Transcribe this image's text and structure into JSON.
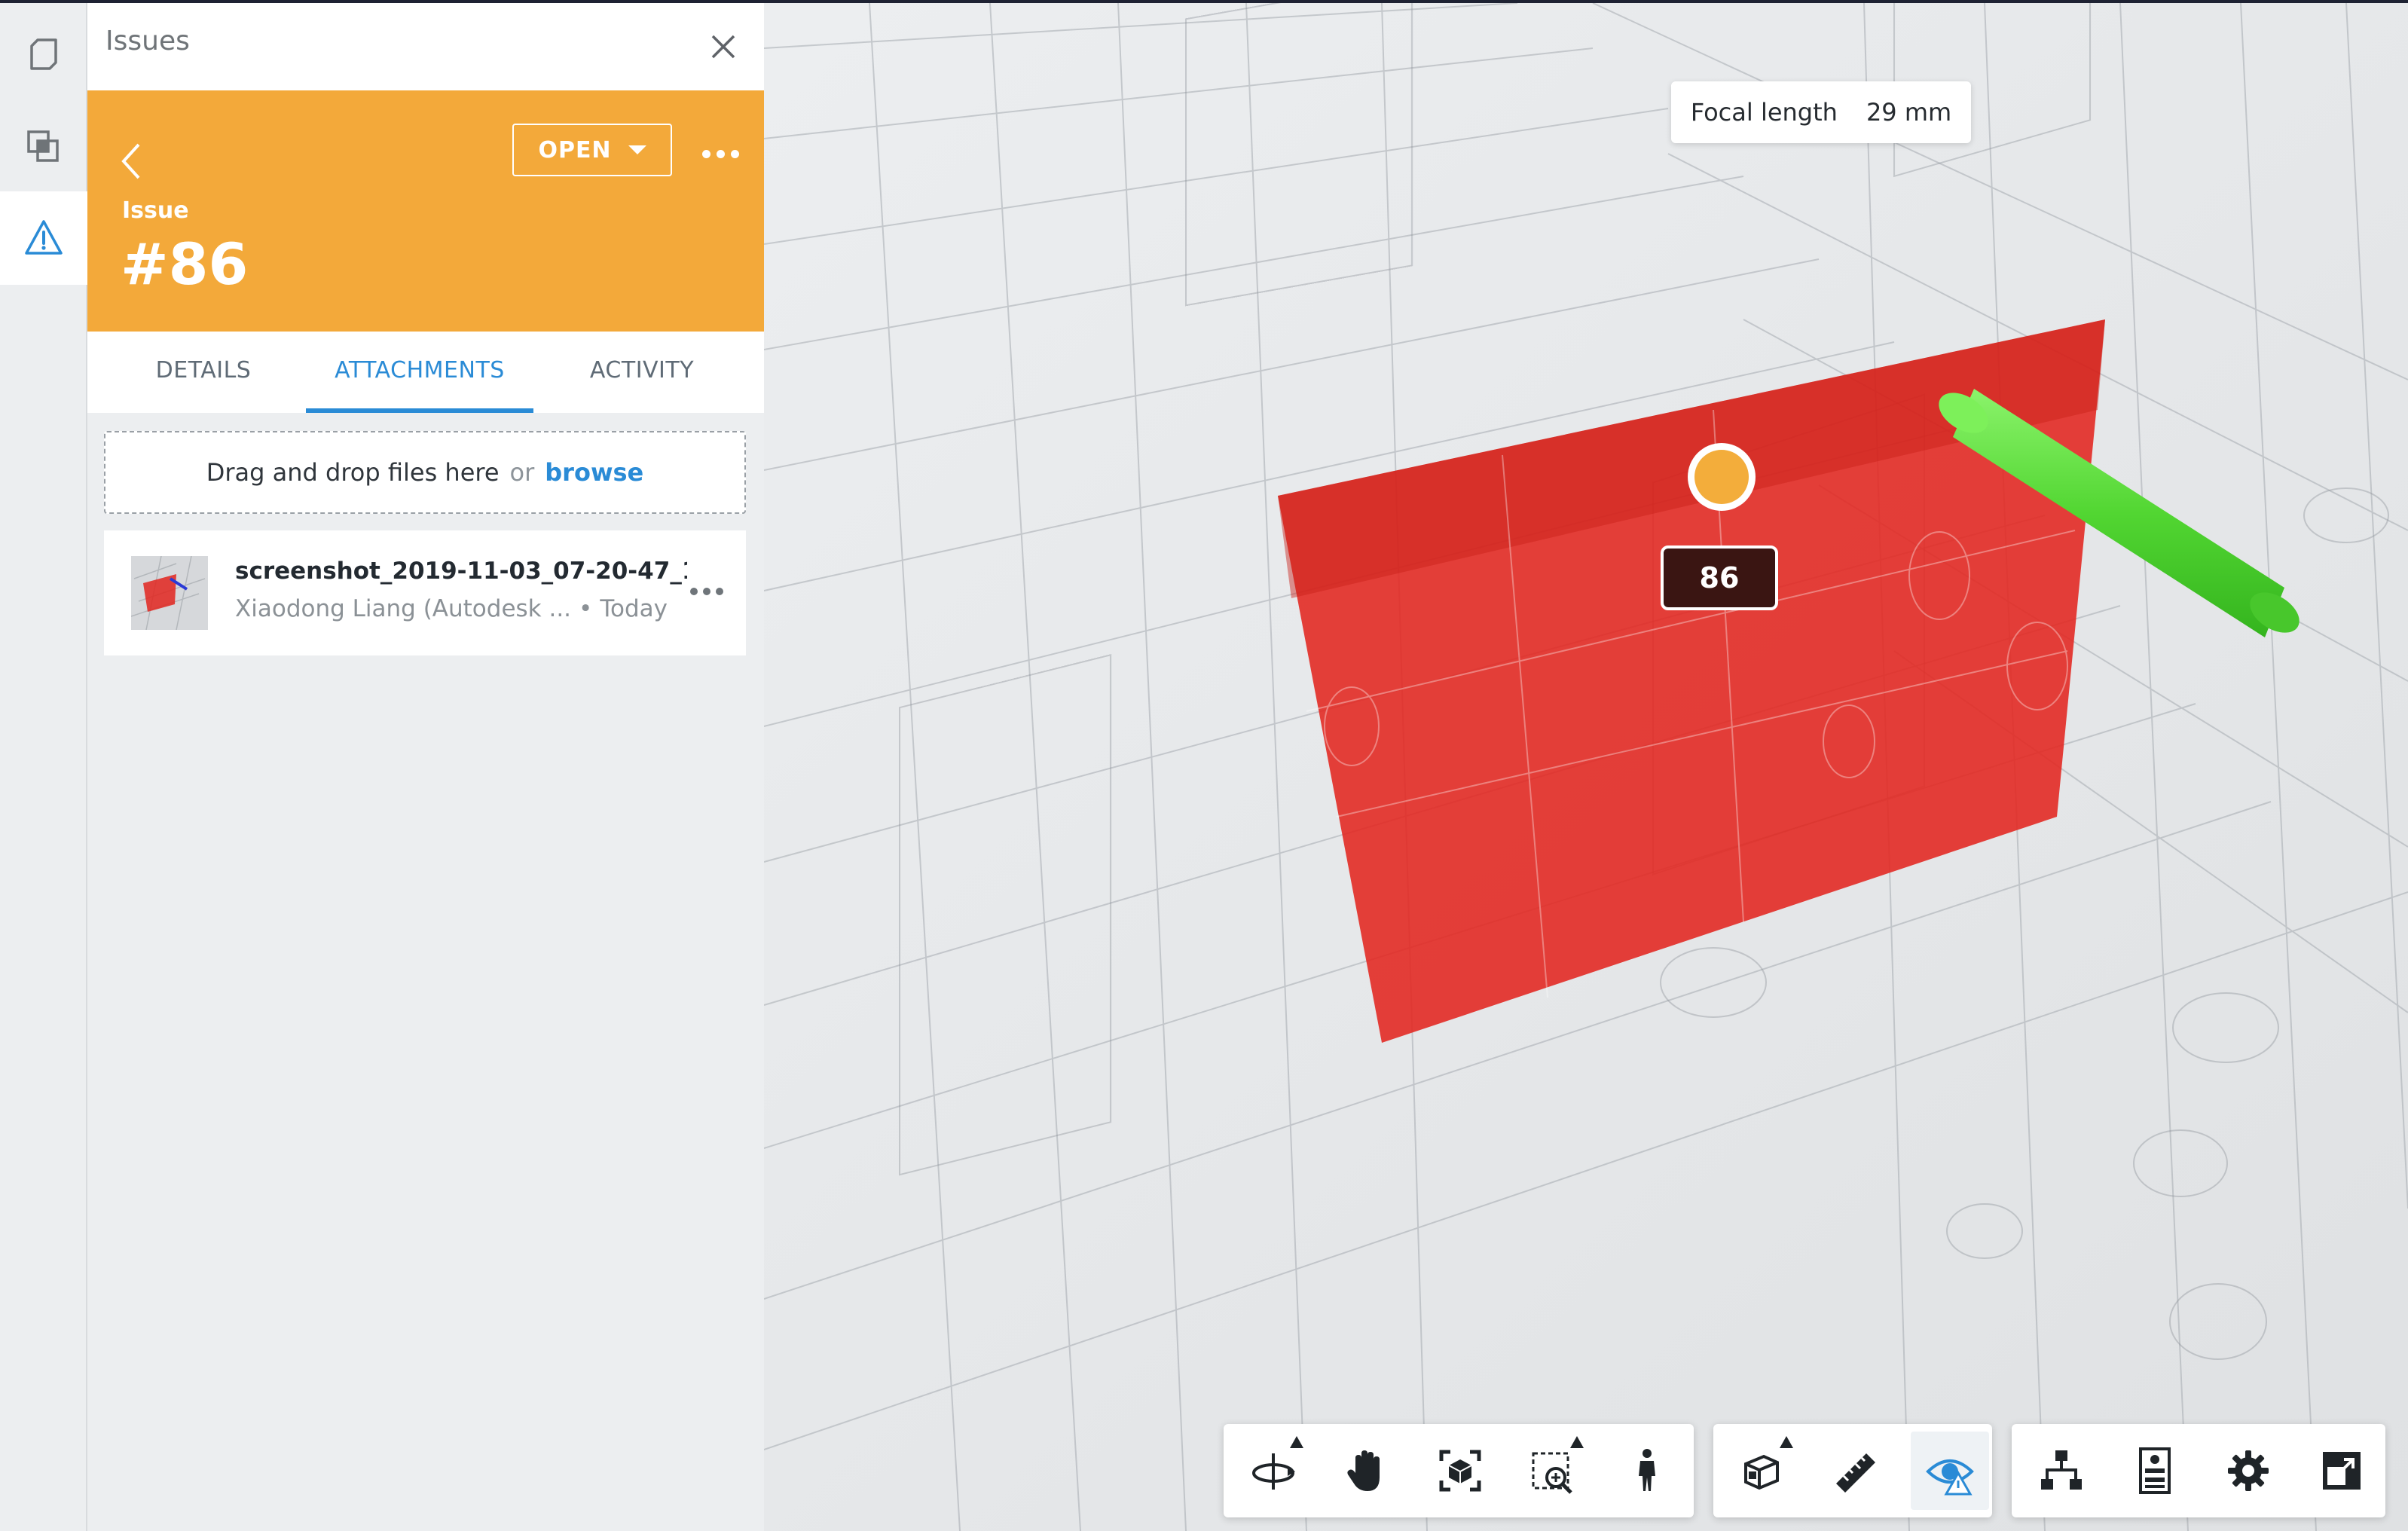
{
  "rail": {
    "items": [
      {
        "name": "model-browser-icon"
      },
      {
        "name": "layers-icon"
      },
      {
        "name": "issues-warning-icon",
        "active": true
      }
    ]
  },
  "panel": {
    "title": "Issues",
    "status_label": "OPEN",
    "issue_label": "Issue",
    "issue_number": "#86",
    "tabs": [
      {
        "label": "DETAILS"
      },
      {
        "label": "ATTACHMENTS",
        "active": true
      },
      {
        "label": "ACTIVITY"
      }
    ],
    "dropzone": {
      "text": "Drag and drop files here",
      "or": "or",
      "browse": "browse"
    },
    "attachments": [
      {
        "file_name": "screenshot_2019-11-03_07-20-47_1...",
        "author": "Xiaodong Liang (Autodesk ...",
        "date": "Today"
      }
    ]
  },
  "viewer": {
    "focal_label": "Focal length",
    "focal_value": "29 mm",
    "pin_label": "86",
    "colors": {
      "clash_red": "#e2261f",
      "pipe_green": "#5ee33c",
      "pin_orange": "#f3ad3b",
      "accent_blue": "#2a8bd6",
      "issue_orange": "#f3a93a"
    }
  },
  "toolbar": {
    "groups": [
      [
        "orbit-icon",
        "pan-hand-icon",
        "fit-to-view-icon",
        "zoom-window-icon",
        "first-person-icon"
      ],
      [
        "section-box-icon",
        "measure-ruler-icon",
        "issues-visibility-icon"
      ],
      [
        "model-browser-tree-icon",
        "properties-icon",
        "settings-gear-icon",
        "fullscreen-icon"
      ]
    ]
  }
}
